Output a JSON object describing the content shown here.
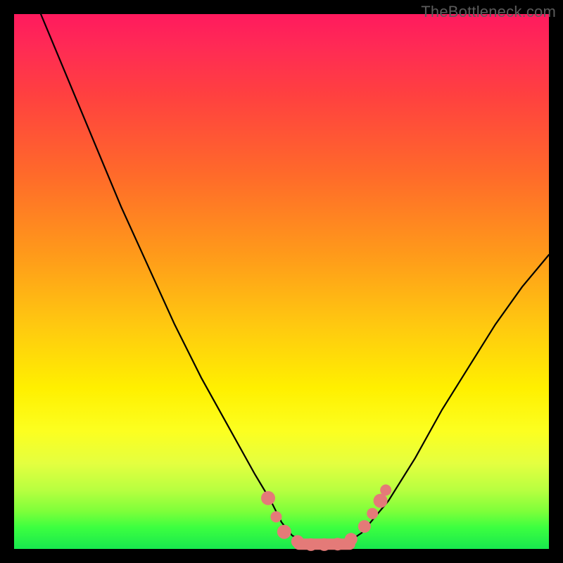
{
  "watermark": "TheBottleneck.com",
  "chart_data": {
    "type": "line",
    "title": "",
    "xlabel": "",
    "ylabel": "",
    "xlim": [
      0,
      100
    ],
    "ylim": [
      0,
      100
    ],
    "grid": false,
    "series": [
      {
        "name": "curve",
        "x": [
          5,
          10,
          15,
          20,
          25,
          30,
          35,
          40,
          45,
          48,
          50,
          52,
          55,
          57,
          60,
          62,
          65,
          70,
          75,
          80,
          85,
          90,
          95,
          100
        ],
        "values": [
          100,
          88,
          76,
          64,
          53,
          42,
          32,
          23,
          14,
          9,
          5,
          2.5,
          1,
          0.5,
          0.5,
          1,
          3,
          9,
          17,
          26,
          34,
          42,
          49,
          55
        ]
      }
    ],
    "markers": {
      "note": "pink rounded markers clustered near the curve floor (bottleneck valley)",
      "color": "#e47a78",
      "points": [
        {
          "x": 47.5,
          "y": 9.5,
          "r": 10
        },
        {
          "x": 49.0,
          "y": 6.0,
          "r": 8
        },
        {
          "x": 50.5,
          "y": 3.2,
          "r": 10
        },
        {
          "x": 53.0,
          "y": 1.4,
          "r": 9
        },
        {
          "x": 55.5,
          "y": 0.8,
          "r": 9
        },
        {
          "x": 58.0,
          "y": 0.8,
          "r": 9
        },
        {
          "x": 60.5,
          "y": 0.9,
          "r": 9
        },
        {
          "x": 63.0,
          "y": 1.8,
          "r": 9
        },
        {
          "x": 65.5,
          "y": 4.2,
          "r": 9
        },
        {
          "x": 67.0,
          "y": 6.6,
          "r": 8
        },
        {
          "x": 68.5,
          "y": 9.0,
          "r": 10
        },
        {
          "x": 69.5,
          "y": 11.0,
          "r": 8
        }
      ]
    }
  }
}
